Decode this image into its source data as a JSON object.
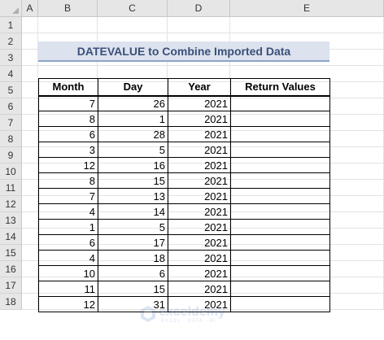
{
  "columns": [
    "A",
    "B",
    "C",
    "D",
    "E"
  ],
  "rows": [
    "1",
    "2",
    "3",
    "4",
    "5",
    "6",
    "7",
    "8",
    "9",
    "10",
    "11",
    "12",
    "13",
    "14",
    "15",
    "16",
    "17",
    "18"
  ],
  "title": "DATEVALUE to Combine Imported Data",
  "table": {
    "headers": [
      "Month",
      "Day",
      "Year",
      "Return Values"
    ],
    "rows": [
      [
        "7",
        "26",
        "2021",
        ""
      ],
      [
        "8",
        "1",
        "2021",
        ""
      ],
      [
        "6",
        "28",
        "2021",
        ""
      ],
      [
        "3",
        "5",
        "2021",
        ""
      ],
      [
        "12",
        "16",
        "2021",
        ""
      ],
      [
        "8",
        "15",
        "2021",
        ""
      ],
      [
        "7",
        "13",
        "2021",
        ""
      ],
      [
        "4",
        "14",
        "2021",
        ""
      ],
      [
        "1",
        "5",
        "2021",
        ""
      ],
      [
        "6",
        "17",
        "2021",
        ""
      ],
      [
        "4",
        "18",
        "2021",
        ""
      ],
      [
        "10",
        "6",
        "2021",
        ""
      ],
      [
        "11",
        "15",
        "2021",
        ""
      ],
      [
        "12",
        "31",
        "2021",
        ""
      ]
    ]
  },
  "watermark": {
    "name": "exceldemy",
    "tagline": "EXCEL · DATA · BI"
  },
  "colors": {
    "header_bg": "#e6e6e6",
    "title_bg": "#dce3ef",
    "title_text": "#3b4f78",
    "watermark": "#3b6fb6"
  }
}
